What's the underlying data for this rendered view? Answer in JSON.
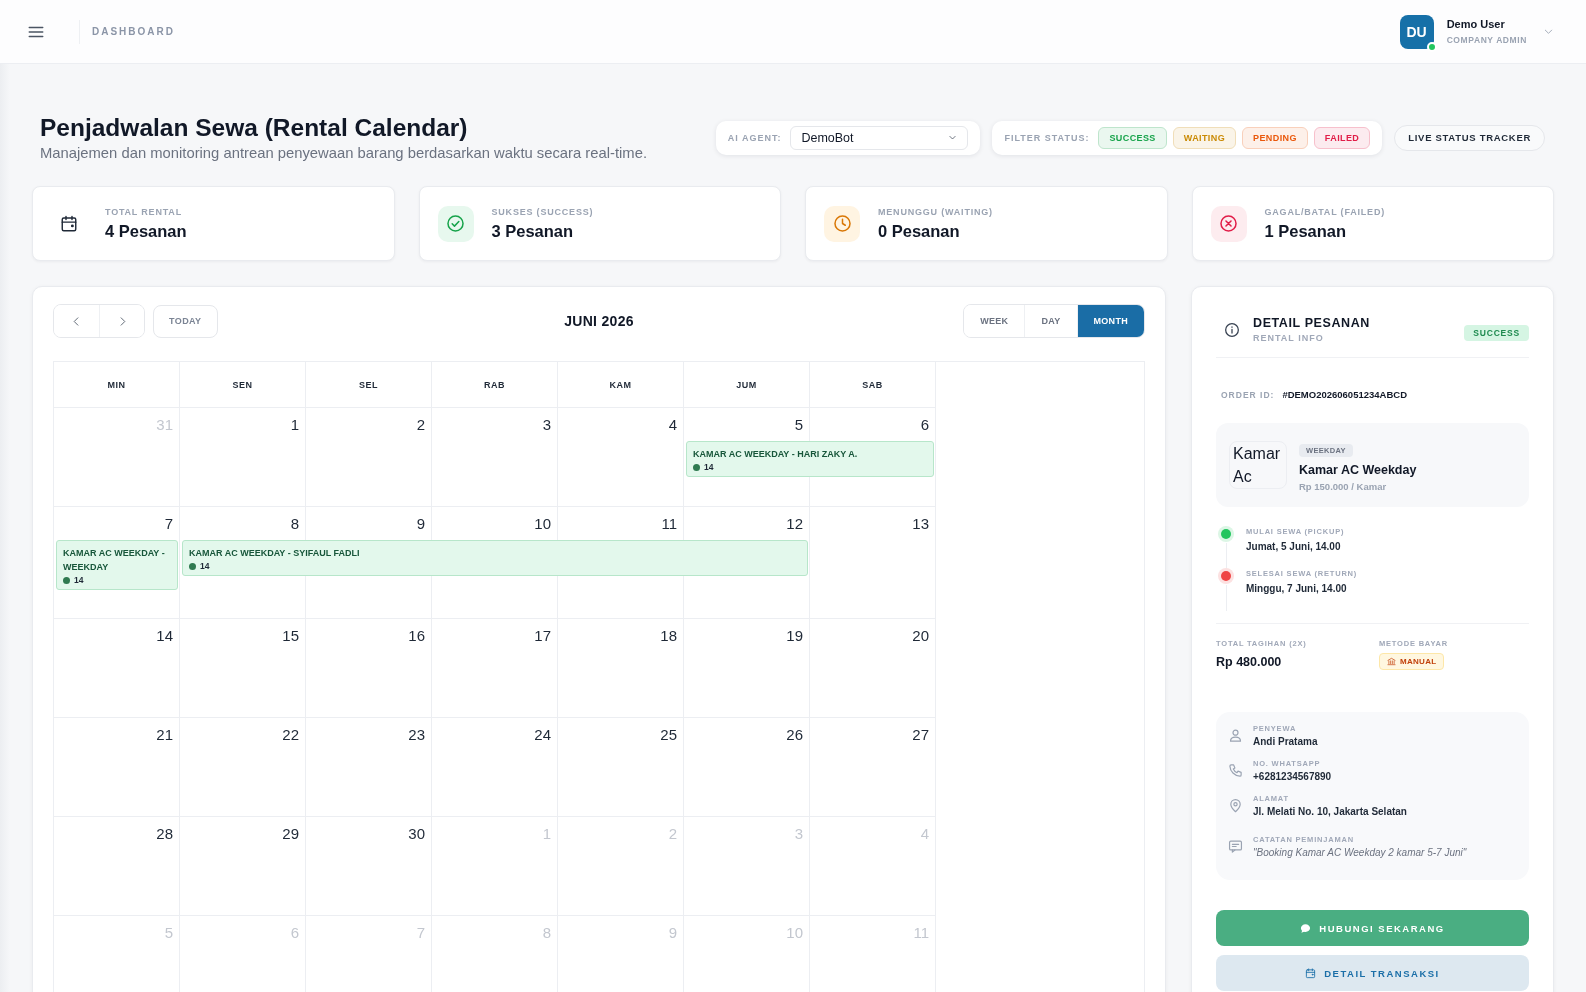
{
  "header": {
    "breadcrumb": "DASHBOARD",
    "user": {
      "initials": "DU",
      "name": "Demo User",
      "role": "COMPANY ADMIN",
      "online": true
    }
  },
  "page": {
    "title": "Penjadwalan Sewa (Rental Calendar)",
    "subtitle": "Manajemen dan monitoring antrean penyewaan barang berdasarkan waktu secara real-time."
  },
  "agent_picker": {
    "label": "AI AGENT:",
    "value": "DemoBot"
  },
  "status_filter": {
    "label": "FILTER STATUS:",
    "options": [
      {
        "label": "SUCCESS",
        "color": "#16a34a"
      },
      {
        "label": "WAITING",
        "color": "#ca8a04"
      },
      {
        "label": "PENDING",
        "color": "#ea580c"
      },
      {
        "label": "FAILED",
        "color": "#e11d48"
      }
    ]
  },
  "live_tracker": {
    "label": "LIVE STATUS TRACKER"
  },
  "stats": [
    {
      "kind": "total",
      "label": "TOTAL RENTAL",
      "value": "4 Pesanan"
    },
    {
      "kind": "success",
      "label": "SUKSES (SUCCESS)",
      "value": "3 Pesanan"
    },
    {
      "kind": "waiting",
      "label": "MENUNGGU (WAITING)",
      "value": "0 Pesanan"
    },
    {
      "kind": "failed",
      "label": "GAGAL/BATAL (FAILED)",
      "value": "1 Pesanan"
    }
  ],
  "calendar": {
    "today_label": "TODAY",
    "title": "JUNI 2026",
    "views": [
      {
        "label": "WEEK",
        "selected": false
      },
      {
        "label": "DAY",
        "selected": false
      },
      {
        "label": "MONTH",
        "selected": true
      }
    ],
    "weekdays": [
      "MIN",
      "SEN",
      "SEL",
      "RAB",
      "KAM",
      "JUM",
      "SAB"
    ],
    "weeks": [
      {
        "spans": [
          {
            "days": [
              {
                "date": "31",
                "other_month": true
              }
            ]
          },
          {
            "days": [
              {
                "date": "1",
                "other_month": false
              }
            ]
          },
          {
            "days": [
              {
                "date": "2",
                "other_month": false
              }
            ]
          },
          {
            "days": [
              {
                "date": "3",
                "other_month": false
              }
            ]
          },
          {
            "days": [
              {
                "date": "4",
                "other_month": false
              }
            ]
          },
          {
            "days": [
              {
                "date": "5",
                "other_month": false
              },
              {
                "date": "6",
                "other_month": false
              }
            ],
            "event": {
              "title": "KAMAR AC WEEKDAY - HARI ZAKY A.",
              "count": "14"
            }
          }
        ]
      },
      {
        "spans": [
          {
            "days": [
              {
                "date": "7",
                "other_month": false
              }
            ],
            "event": {
              "title": "KAMAR AC WEEKDAY - WEEKDAY",
              "count": "14"
            }
          },
          {
            "days": [
              {
                "date": "8",
                "other_month": false
              },
              {
                "date": "9",
                "other_month": false
              },
              {
                "date": "10",
                "other_month": false
              },
              {
                "date": "11",
                "other_month": false
              },
              {
                "date": "12",
                "other_month": false
              }
            ],
            "event": {
              "title": "KAMAR AC WEEKDAY - SYIFAUL FADLI",
              "count": "14"
            }
          },
          {
            "days": [
              {
                "date": "13",
                "other_month": false
              }
            ]
          }
        ]
      },
      {
        "spans": [
          {
            "days": [
              {
                "date": "14",
                "other_month": false
              }
            ]
          },
          {
            "days": [
              {
                "date": "15",
                "other_month": false
              }
            ]
          },
          {
            "days": [
              {
                "date": "16",
                "other_month": false
              }
            ]
          },
          {
            "days": [
              {
                "date": "17",
                "other_month": false
              }
            ]
          },
          {
            "days": [
              {
                "date": "18",
                "other_month": false
              }
            ]
          },
          {
            "days": [
              {
                "date": "19",
                "other_month": false
              }
            ]
          },
          {
            "days": [
              {
                "date": "20",
                "other_month": false
              }
            ]
          }
        ]
      },
      {
        "spans": [
          {
            "days": [
              {
                "date": "21",
                "other_month": false
              }
            ]
          },
          {
            "days": [
              {
                "date": "22",
                "other_month": false
              }
            ]
          },
          {
            "days": [
              {
                "date": "23",
                "other_month": false
              }
            ]
          },
          {
            "days": [
              {
                "date": "24",
                "other_month": false
              }
            ]
          },
          {
            "days": [
              {
                "date": "25",
                "other_month": false
              }
            ]
          },
          {
            "days": [
              {
                "date": "26",
                "other_month": false
              }
            ]
          },
          {
            "days": [
              {
                "date": "27",
                "other_month": false
              }
            ]
          }
        ]
      },
      {
        "spans": [
          {
            "days": [
              {
                "date": "28",
                "other_month": false
              }
            ]
          },
          {
            "days": [
              {
                "date": "29",
                "other_month": false
              }
            ]
          },
          {
            "days": [
              {
                "date": "30",
                "other_month": false
              }
            ]
          },
          {
            "days": [
              {
                "date": "1",
                "other_month": true
              }
            ]
          },
          {
            "days": [
              {
                "date": "2",
                "other_month": true
              }
            ]
          },
          {
            "days": [
              {
                "date": "3",
                "other_month": true
              }
            ]
          },
          {
            "days": [
              {
                "date": "4",
                "other_month": true
              }
            ]
          }
        ]
      },
      {
        "spans": [
          {
            "days": [
              {
                "date": "5",
                "other_month": true
              }
            ]
          },
          {
            "days": [
              {
                "date": "6",
                "other_month": true
              }
            ]
          },
          {
            "days": [
              {
                "date": "7",
                "other_month": true
              }
            ]
          },
          {
            "days": [
              {
                "date": "8",
                "other_month": true
              }
            ]
          },
          {
            "days": [
              {
                "date": "9",
                "other_month": true
              }
            ]
          },
          {
            "days": [
              {
                "date": "10",
                "other_month": true
              }
            ]
          },
          {
            "days": [
              {
                "date": "11",
                "other_month": true
              }
            ]
          }
        ]
      }
    ]
  },
  "detail": {
    "title": "DETAIL PESANAN",
    "subtitle": "RENTAL INFO",
    "status": "SUCCESS",
    "order_id_label": "ORDER ID:",
    "order_id": "#DEMO202606051234ABCD",
    "product": {
      "image_alt": "Kamar Ac",
      "tag": "WEEKDAY",
      "name": "Kamar AC Weekday",
      "price": "Rp 150.000 / Kamar"
    },
    "timeline": [
      {
        "label": "MULAI SEWA (PICKUP)",
        "value": "Jumat, 5 Juni, 14.00",
        "color": "#22c55e"
      },
      {
        "label": "SELESAI SEWA (RETURN)",
        "value": "Minggu, 7 Juni, 14.00",
        "color": "#ef4444"
      }
    ],
    "total": {
      "label": "TOTAL TAGIHAN (2X)",
      "value": "Rp 480.000"
    },
    "payment": {
      "label": "METODE BAYAR",
      "value": "MANUAL"
    },
    "renter": [
      {
        "kind": "person",
        "label": "PENYEWA",
        "value": "Andi Pratama"
      },
      {
        "kind": "phone",
        "label": "NO. WHATSAPP",
        "value": "+6281234567890"
      },
      {
        "kind": "location",
        "label": "ALAMAT",
        "value": "Jl. Melati No. 10, Jakarta Selatan"
      },
      {
        "kind": "note",
        "label": "CATATAN PEMINJAMAN",
        "value": "\"Booking Kamar AC Weekday 2 kamar 5-7 Juni\""
      }
    ],
    "buttons": [
      {
        "kind": "primary",
        "label": "HUBUNGI SEKARANG"
      },
      {
        "kind": "secondary",
        "label": "DETAIL TRANSAKSI"
      }
    ]
  }
}
